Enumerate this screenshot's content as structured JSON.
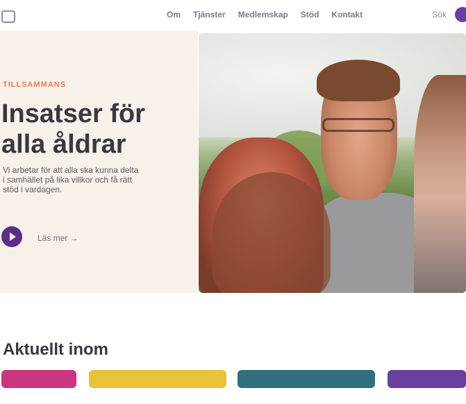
{
  "header": {
    "nav": [
      "Om",
      "Tjänster",
      "Medlemskap",
      "Stöd",
      "Kontakt"
    ],
    "right_label": "Sök",
    "accent": "#6b3fa0"
  },
  "hero": {
    "eyebrow": "Tillsammans",
    "title": "Insatser för\nalla åldrar",
    "description": "Vi arbetar för att alla ska kunna delta i samhället på lika villkor och få rätt stöd i vardagen.",
    "read_more": "Läs mer →",
    "colors": {
      "background": "#f7f1ea",
      "eyebrow": "#f07a4e",
      "button": "#5a2f86"
    }
  },
  "section": {
    "title": "Aktuellt inom",
    "cards": [
      {
        "color": "#c9357f"
      },
      {
        "color": "#e9c237"
      },
      {
        "color": "#2f6f7e"
      },
      {
        "color": "#6b3fa0"
      }
    ]
  }
}
